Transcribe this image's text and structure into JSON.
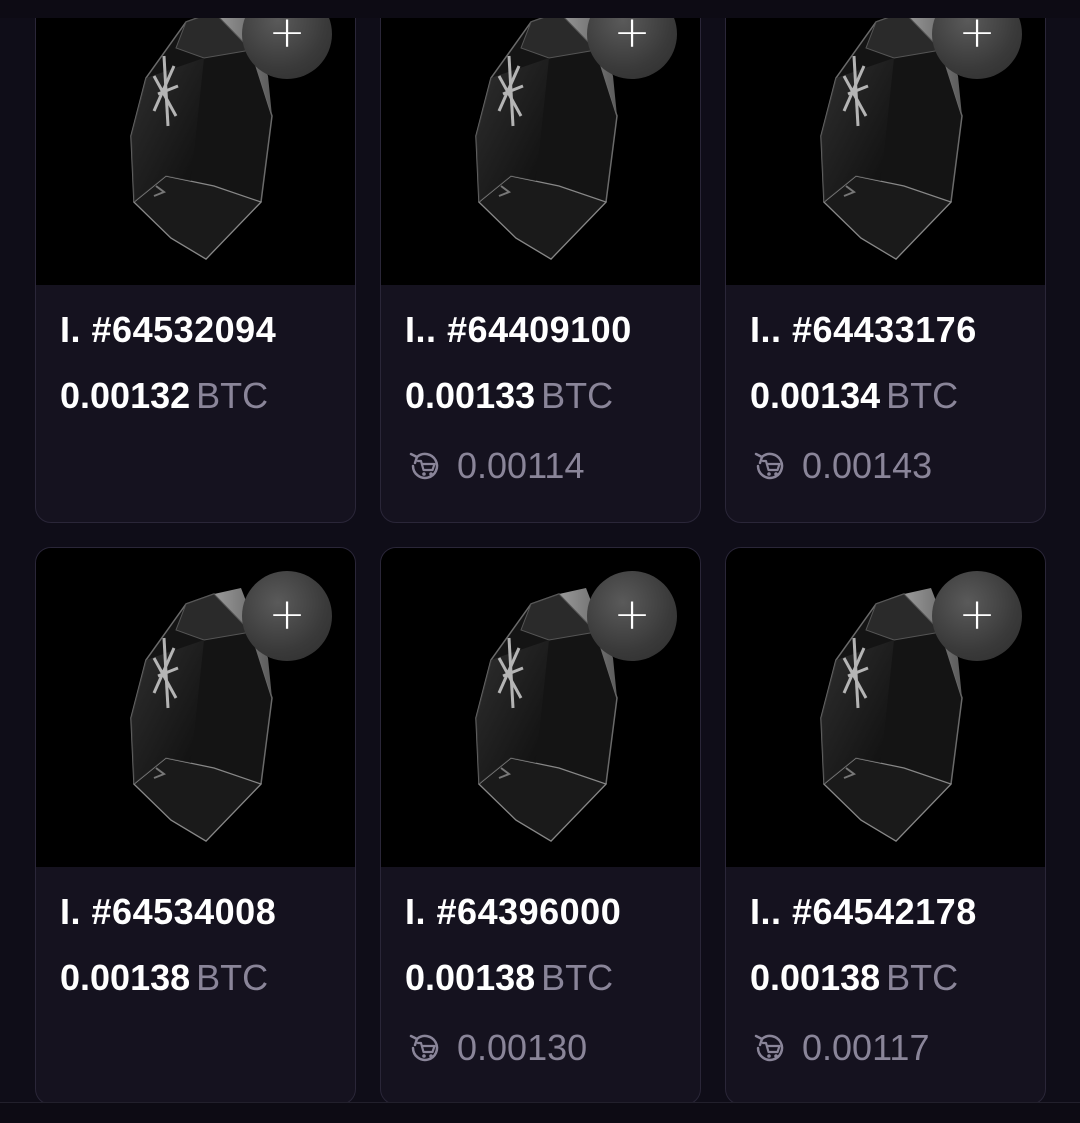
{
  "currency": "BTC",
  "cards": [
    {
      "name_prefix": "I.",
      "number": "#64532094",
      "price": "0.00132",
      "last_sale": null
    },
    {
      "name_prefix": "I..",
      "number": "#64409100",
      "price": "0.00133",
      "last_sale": "0.00114"
    },
    {
      "name_prefix": "I..",
      "number": "#64433176",
      "price": "0.00134",
      "last_sale": "0.00143"
    },
    {
      "name_prefix": "I.",
      "number": "#64534008",
      "price": "0.00138",
      "last_sale": null
    },
    {
      "name_prefix": "I.",
      "number": "#64396000",
      "price": "0.00138",
      "last_sale": "0.00130"
    },
    {
      "name_prefix": "I..",
      "number": "#64542178",
      "price": "0.00138",
      "last_sale": "0.00117"
    }
  ],
  "icons": {
    "add": "plus-icon",
    "last_sale": "cart-refresh-icon",
    "artwork": "crystal-artwork"
  },
  "colors": {
    "background": "#0f0d18",
    "card": "#15121f",
    "card_border": "#2a2638",
    "muted_text": "#8a8599"
  }
}
